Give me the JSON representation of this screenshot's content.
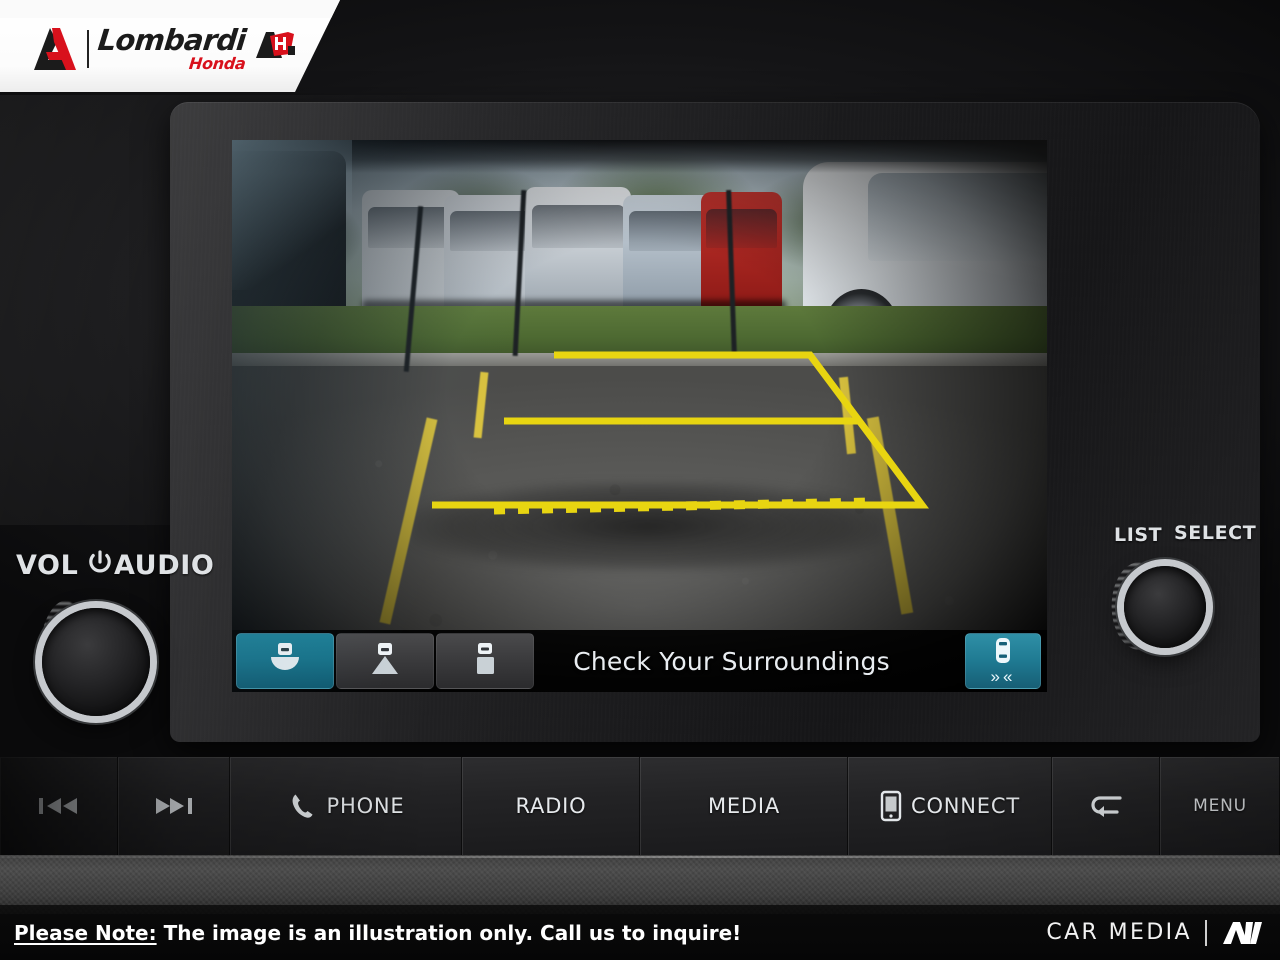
{
  "header": {
    "dealer_name": "Lombardi",
    "dealer_brand": "Honda",
    "logo_mark": "lh-monogram",
    "badge": "honda-award-badge"
  },
  "infotainment": {
    "screen": {
      "message": "Check Your Surroundings",
      "mode": "rear-view-camera",
      "view_buttons": [
        {
          "id": "wide-view",
          "icon": "camera-wide-view-icon",
          "active": true
        },
        {
          "id": "normal-view",
          "icon": "camera-normal-view-icon",
          "active": false
        },
        {
          "id": "top-down-view",
          "icon": "camera-topdown-view-icon",
          "active": false
        }
      ],
      "guideline_button": {
        "id": "dynamic-guidelines",
        "icon": "car-top-icon",
        "chevrons": "»«",
        "active": true
      },
      "guidelines": {
        "color": "#e8d511",
        "dashed_color": "#e8d511",
        "shape": "trapezoid-with-crossbar"
      }
    },
    "left_knob": {
      "label_vol": "VOL",
      "label_audio": "AUDIO",
      "power_icon": "power-icon"
    },
    "right_knob": {
      "label_list": "LIST",
      "label_select": "SELECT"
    },
    "hard_buttons": [
      {
        "id": "prev-track",
        "label": "",
        "icon": "previous-track-icon"
      },
      {
        "id": "next-track",
        "label": "",
        "icon": "next-track-icon"
      },
      {
        "id": "phone",
        "label": "PHONE",
        "icon": "phone-icon"
      },
      {
        "id": "radio",
        "label": "RADIO",
        "icon": ""
      },
      {
        "id": "media",
        "label": "MEDIA",
        "icon": ""
      },
      {
        "id": "connect",
        "label": "CONNECT",
        "icon": "smartphone-icon"
      },
      {
        "id": "back",
        "label": "",
        "icon": "back-arrow-icon"
      },
      {
        "id": "menu",
        "label": "MENU",
        "icon": ""
      }
    ]
  },
  "footer": {
    "note_label": "Please Note:",
    "note_text": " The image is an illustration only. Call us to inquire!",
    "watermark": "CAR MEDIA",
    "watermark_mark": "av-logo-icon"
  },
  "colors": {
    "accent_teal": "#1d7f96",
    "guideline_yellow": "#e8d511",
    "brand_red": "#d8111c"
  }
}
